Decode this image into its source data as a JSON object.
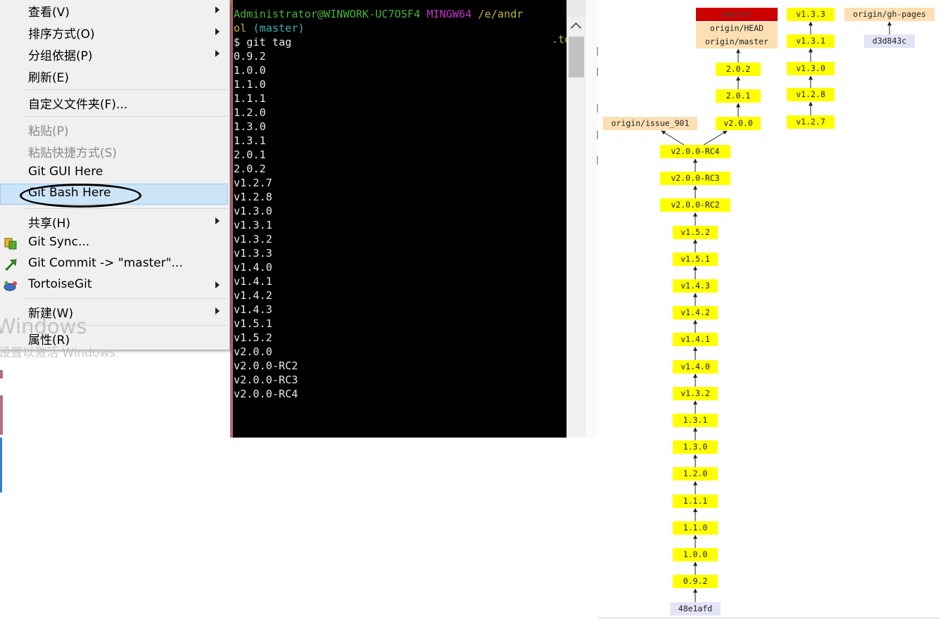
{
  "menu": {
    "items": [
      {
        "label": "查看(V)",
        "submenu": true
      },
      {
        "label": "排序方式(O)",
        "submenu": true
      },
      {
        "label": "分组依据(P)",
        "submenu": true
      },
      {
        "label": "刷新(E)",
        "submenu": false
      },
      {
        "label": "自定义文件夹(F)...",
        "submenu": false
      },
      {
        "label": "粘贴(P)",
        "submenu": false,
        "disabled": true
      },
      {
        "label": "粘贴快捷方式(S)",
        "submenu": false,
        "disabled": true
      },
      {
        "label": "Git GUI Here",
        "submenu": false
      },
      {
        "label": "Git Bash Here",
        "submenu": false,
        "highlighted": true
      },
      {
        "label": "共享(H)",
        "submenu": true
      },
      {
        "label": "Git Sync...",
        "submenu": false,
        "icon": "git-sync-icon"
      },
      {
        "label": "Git Commit -> \"master\"...",
        "submenu": false,
        "icon": "git-commit-icon"
      },
      {
        "label": "TortoiseGit",
        "submenu": true,
        "icon": "tortoisegit-icon"
      },
      {
        "label": "新建(W)",
        "submenu": true
      },
      {
        "label": "属性(R)",
        "submenu": false
      }
    ]
  },
  "watermark": {
    "line1": "Windows",
    "line2": "设置以激活 Windows"
  },
  "terminal": {
    "prompt_user": "Administrator@WINWORK-UC7OSF4",
    "prompt_env": "MINGW64",
    "prompt_path": "/e/andr",
    "prompt_path_cont": "ol",
    "prompt_branch": "(master)",
    "command": "$ git tag",
    "ghost_text": ".to",
    "tags": [
      "0.9.2",
      "1.0.0",
      "1.1.0",
      "1.1.1",
      "1.2.0",
      "1.3.0",
      "1.3.1",
      "2.0.1",
      "2.0.2",
      "v1.2.7",
      "v1.2.8",
      "v1.3.0",
      "v1.3.1",
      "v1.3.2",
      "v1.3.3",
      "v1.4.0",
      "v1.4.1",
      "v1.4.2",
      "v1.4.3",
      "v1.5.1",
      "v1.5.2",
      "v2.0.0",
      "v2.0.0-RC2",
      "v2.0.0-RC3",
      "v2.0.0-RC4"
    ]
  },
  "graph": {
    "main_chain": [
      "v2.0.0-RC4",
      "v2.0.0-RC3",
      "v2.0.0-RC2",
      "v1.5.2",
      "v1.5.1",
      "v1.4.3",
      "v1.4.2",
      "v1.4.1",
      "v1.4.0",
      "v1.3.2",
      "1.3.1",
      "1.3.0",
      "1.2.0",
      "1.1.1",
      "1.1.0",
      "1.0.0",
      "0.9.2"
    ],
    "root_commit": "48e1afd",
    "branch_label": "origin/issue_901",
    "master_chain": [
      "v2.0.0",
      "2.0.1",
      "2.0.2"
    ],
    "master_refs": {
      "master": "master",
      "head": "origin/HEAD",
      "origin_master": "origin/master"
    },
    "side_chain": [
      "v1.3.3",
      "v1.3.1",
      "v1.3.0",
      "v1.2.8",
      "v1.2.7"
    ],
    "gh_pages": {
      "ref": "origin/gh-pages",
      "commit": "d3d843c"
    },
    "colors": {
      "tag": "#ffff00",
      "branch": "#fce0b4",
      "current": "#cc0000",
      "commit": "#e4e4f8"
    }
  }
}
